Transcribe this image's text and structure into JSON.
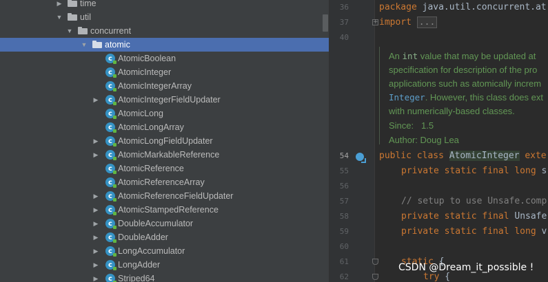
{
  "tree": {
    "items": [
      {
        "label": "time",
        "kind": "folder",
        "arrow": "▶"
      },
      {
        "label": "util",
        "kind": "folder",
        "arrow": "▼"
      },
      {
        "label": "concurrent",
        "kind": "folder",
        "arrow": "▼"
      },
      {
        "label": "atomic",
        "kind": "folder",
        "arrow": "▼",
        "selected": true
      },
      {
        "label": "AtomicBoolean",
        "kind": "class",
        "arrow": ""
      },
      {
        "label": "AtomicInteger",
        "kind": "class",
        "arrow": ""
      },
      {
        "label": "AtomicIntegerArray",
        "kind": "class",
        "arrow": ""
      },
      {
        "label": "AtomicIntegerFieldUpdater",
        "kind": "class",
        "arrow": "▶"
      },
      {
        "label": "AtomicLong",
        "kind": "class",
        "arrow": ""
      },
      {
        "label": "AtomicLongArray",
        "kind": "class",
        "arrow": ""
      },
      {
        "label": "AtomicLongFieldUpdater",
        "kind": "class",
        "arrow": "▶"
      },
      {
        "label": "AtomicMarkableReference",
        "kind": "class",
        "arrow": "▶"
      },
      {
        "label": "AtomicReference",
        "kind": "class",
        "arrow": ""
      },
      {
        "label": "AtomicReferenceArray",
        "kind": "class",
        "arrow": ""
      },
      {
        "label": "AtomicReferenceFieldUpdater",
        "kind": "class",
        "arrow": "▶"
      },
      {
        "label": "AtomicStampedReference",
        "kind": "class",
        "arrow": "▶"
      },
      {
        "label": "DoubleAccumulator",
        "kind": "class",
        "arrow": "▶"
      },
      {
        "label": "DoubleAdder",
        "kind": "class",
        "arrow": "▶"
      },
      {
        "label": "LongAccumulator",
        "kind": "class",
        "arrow": "▶"
      },
      {
        "label": "LongAdder",
        "kind": "class",
        "arrow": "▶"
      },
      {
        "label": "Striped64",
        "kind": "class",
        "arrow": "▶"
      }
    ]
  },
  "editor": {
    "lines": {
      "l36": "36",
      "l37": "37",
      "l40": "40",
      "l54": "54",
      "l55": "55",
      "l56": "56",
      "l57": "57",
      "l58": "58",
      "l59": "59",
      "l60": "60",
      "l61": "61",
      "l62": "62"
    },
    "code": {
      "pkg_kw": "package",
      "pkg_name": " java.util.concurrent.at",
      "imp_kw": "import",
      "imp_fold": "...",
      "cls_kw": "public class ",
      "cls_name": "AtomicInteger",
      "cls_rest": " exte",
      "f1_kw": "private static final long",
      "f1_rest": " s",
      "cmt": "// setup to use Unsafe.comp",
      "f2_kw": "private static final",
      "f2_rest": " Unsafe",
      "f3_kw": "private static final long",
      "f3_rest": " v",
      "static_kw": "static",
      "static_rest": " {",
      "try_kw": "try",
      "try_rest": " {"
    },
    "doc": {
      "l1a": "An ",
      "l1b": "int",
      "l1c": " value that may be updated at",
      "l2": "specification for description of the pro",
      "l3": "applications such as atomically increm",
      "l4a": "Integer",
      "l4b": ". However, this class does ext",
      "l5": "with numerically-based classes.",
      "since_label": "Since:",
      "since_value": "1.5",
      "author": "Author: Doug Lea"
    }
  },
  "watermark": "CSDN @Dream_it_possible !"
}
